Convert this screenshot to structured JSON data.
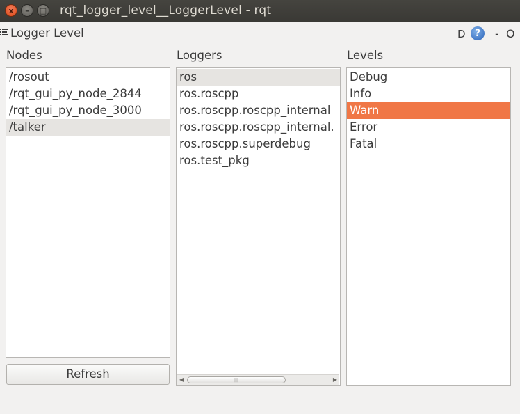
{
  "window": {
    "title": "rqt_logger_level__LoggerLevel - rqt",
    "close_glyph": "x",
    "minimize_glyph": "–",
    "maximize_glyph": "□"
  },
  "plugin": {
    "title": "Logger Level",
    "d_button": "D",
    "help_glyph": "?",
    "minus_button": "-",
    "close_button": "O"
  },
  "nodes": {
    "label": "Nodes",
    "items": [
      "/rosout",
      "/rqt_gui_py_node_2844",
      "/rqt_gui_py_node_3000",
      "/talker"
    ],
    "selected_index": 3,
    "refresh_label": "Refresh"
  },
  "loggers": {
    "label": "Loggers",
    "items": [
      "ros",
      "ros.roscpp",
      "ros.roscpp.roscpp_internal",
      "ros.roscpp.roscpp_internal.",
      "ros.roscpp.superdebug",
      "ros.test_pkg"
    ],
    "selected_index": 0,
    "scroll_left_glyph": "◀",
    "scroll_right_glyph": "▶",
    "scroll_grip_glyph": "|||"
  },
  "levels": {
    "label": "Levels",
    "items": [
      "Debug",
      "Info",
      "Warn",
      "Error",
      "Fatal"
    ],
    "selected_index": 2
  },
  "colors": {
    "selection_accent": "#f07746",
    "selection_inactive": "#e6e4e1",
    "titlebar": "#3c3b37"
  }
}
